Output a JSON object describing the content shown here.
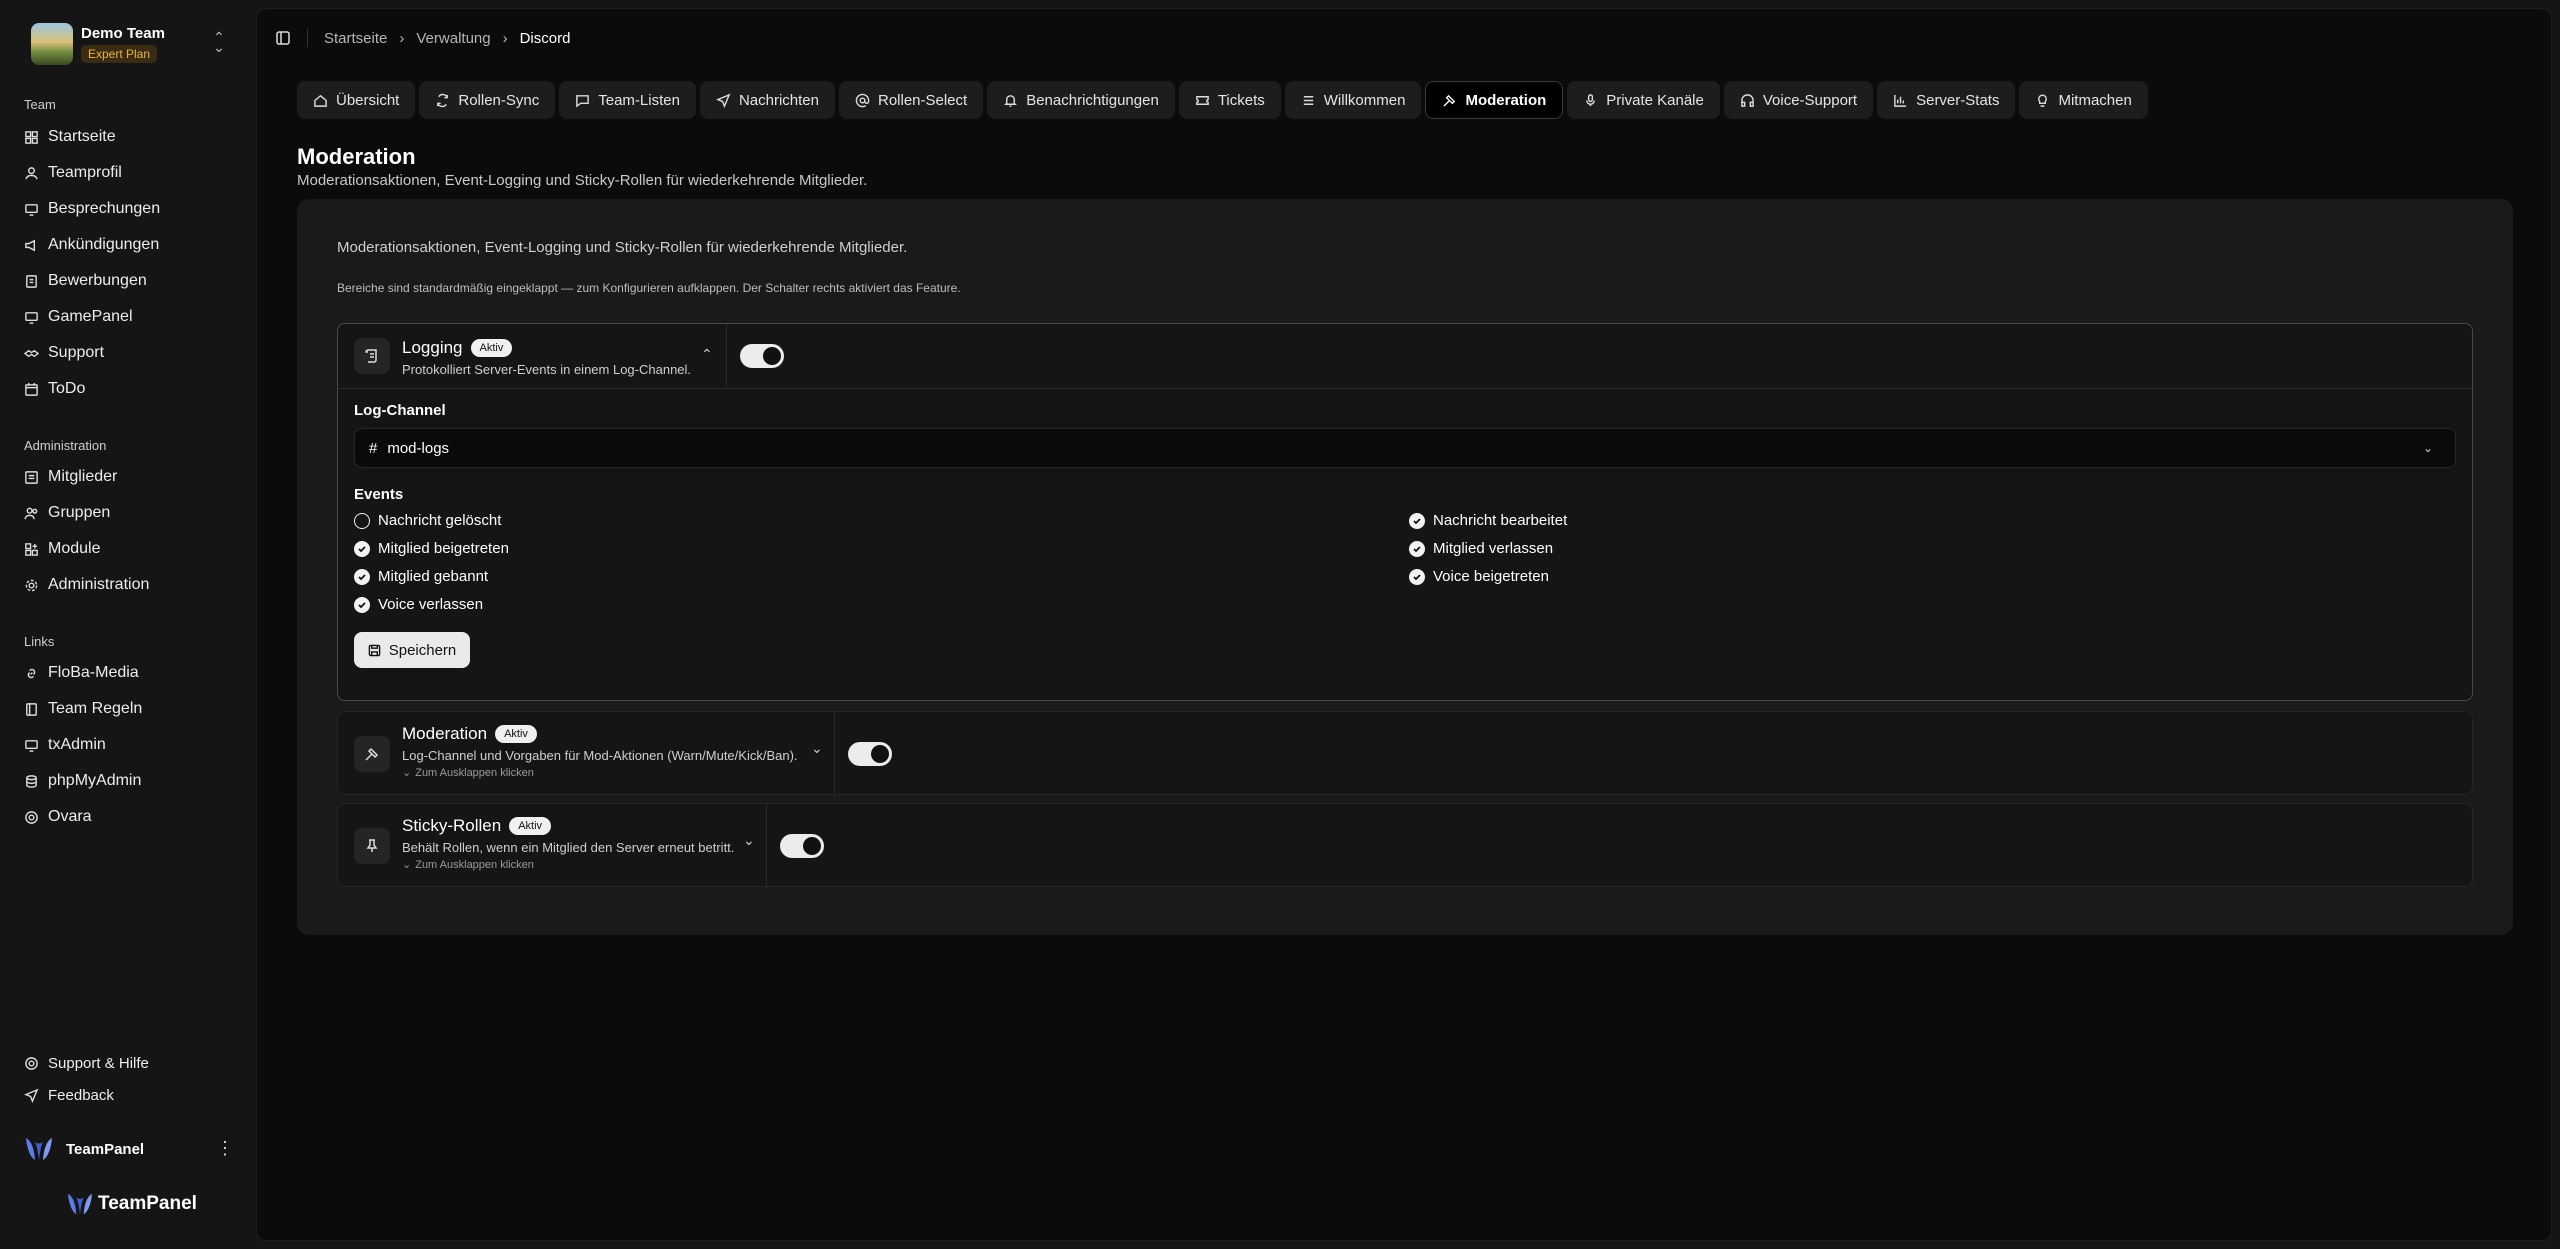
{
  "team": {
    "name": "Demo Team",
    "plan": "Expert Plan"
  },
  "sidebar": {
    "sections": [
      {
        "title": "Team",
        "items": [
          {
            "label": "Startseite",
            "icon": "home-grid-icon"
          },
          {
            "label": "Teamprofil",
            "icon": "user-icon"
          },
          {
            "label": "Besprechungen",
            "icon": "monitor-icon"
          },
          {
            "label": "Ankündigungen",
            "icon": "megaphone-icon"
          },
          {
            "label": "Bewerbungen",
            "icon": "document-icon"
          },
          {
            "label": "GamePanel",
            "icon": "monitor-icon"
          },
          {
            "label": "Support",
            "icon": "handshake-icon"
          },
          {
            "label": "ToDo",
            "icon": "calendar-icon"
          }
        ]
      },
      {
        "title": "Administration",
        "items": [
          {
            "label": "Mitglieder",
            "icon": "list-icon"
          },
          {
            "label": "Gruppen",
            "icon": "users-icon"
          },
          {
            "label": "Module",
            "icon": "modules-icon"
          },
          {
            "label": "Administration",
            "icon": "gear-icon"
          }
        ]
      },
      {
        "title": "Links",
        "items": [
          {
            "label": "FloBa-Media",
            "icon": "link-icon"
          },
          {
            "label": "Team Regeln",
            "icon": "book-icon"
          },
          {
            "label": "txAdmin",
            "icon": "monitor-icon"
          },
          {
            "label": "phpMyAdmin",
            "icon": "database-icon"
          },
          {
            "label": "Ovara",
            "icon": "circle-icon"
          }
        ]
      }
    ],
    "footer": {
      "support": "Support & Hilfe",
      "feedback": "Feedback"
    },
    "user": "TeamPanel",
    "brand": "TeamPanel"
  },
  "breadcrumb": {
    "items": [
      "Startseite",
      "Verwaltung"
    ],
    "current": "Discord"
  },
  "tabs": [
    "Übersicht",
    "Rollen-Sync",
    "Team-Listen",
    "Nachrichten",
    "Rollen-Select",
    "Benachrichtigungen",
    "Tickets",
    "Willkommen",
    "Moderation",
    "Private Kanäle",
    "Voice-Support",
    "Server-Stats",
    "Mitmachen"
  ],
  "active_tab": "Moderation",
  "page": {
    "title": "Moderation",
    "subtitle": "Moderationsaktionen, Event-Logging und Sticky-Rollen für wiederkehrende Mitglieder.",
    "panel_desc": "Moderationsaktionen, Event-Logging und Sticky-Rollen für wiederkehrende Mitglieder.",
    "panel_hint": "Bereiche sind standardmäßig eingeklappt — zum Konfigurieren aufklappen. Der Schalter rechts aktiviert das Feature."
  },
  "logging": {
    "title": "Logging",
    "badge": "Aktiv",
    "desc": "Protokolliert Server-Events in einem Log-Channel.",
    "enabled": true,
    "channel_label": "Log-Channel",
    "channel": "mod-logs",
    "events_label": "Events",
    "events": [
      {
        "label": "Nachricht gelöscht",
        "checked": false
      },
      {
        "label": "Nachricht bearbeitet",
        "checked": true
      },
      {
        "label": "Mitglied beigetreten",
        "checked": true
      },
      {
        "label": "Mitglied verlassen",
        "checked": true
      },
      {
        "label": "Mitglied gebannt",
        "checked": true
      },
      {
        "label": "Voice beigetreten",
        "checked": true
      },
      {
        "label": "Voice verlassen",
        "checked": true
      }
    ],
    "save_label": "Speichern"
  },
  "moderation": {
    "title": "Moderation",
    "badge": "Aktiv",
    "desc": "Log-Channel und Vorgaben für Mod-Aktionen (Warn/Mute/Kick/Ban).",
    "expand": "Zum Ausklappen klicken",
    "enabled": true
  },
  "sticky": {
    "title": "Sticky-Rollen",
    "badge": "Aktiv",
    "desc": "Behält Rollen, wenn ein Mitglied den Server erneut betritt.",
    "expand": "Zum Ausklappen klicken",
    "enabled": true
  }
}
